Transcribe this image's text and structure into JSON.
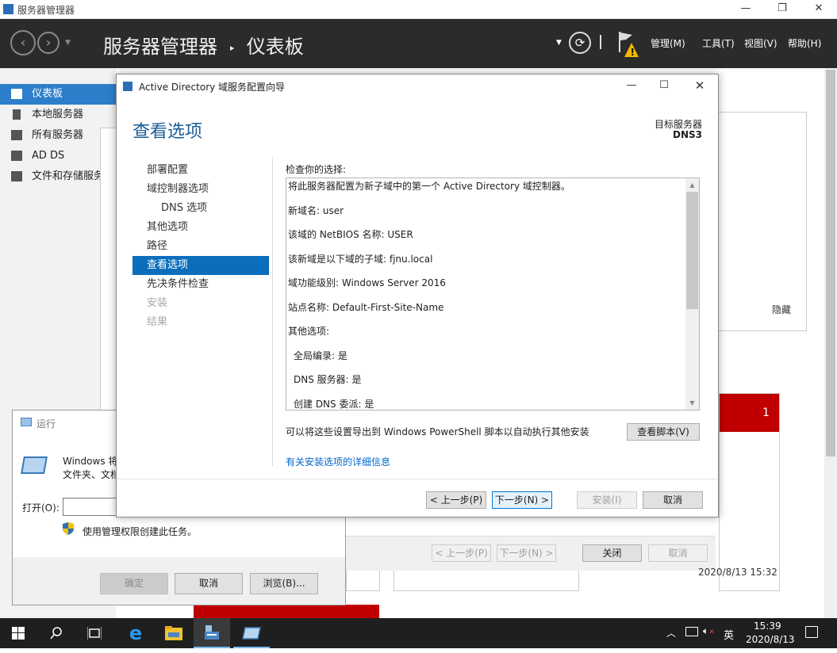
{
  "server_manager": {
    "title": "服务器管理器",
    "breadcrumb_app": "服务器管理器",
    "breadcrumb_sep": "‣",
    "breadcrumb_page": "仪表板",
    "menu": [
      "管理(M)",
      "工具(T)",
      "视图(V)",
      "帮助(H)"
    ],
    "sidebar": [
      "仪表板",
      "本地服务器",
      "所有服务器",
      "AD DS",
      "文件和存储服务"
    ],
    "hide_label": "隐藏",
    "alert_count": "1",
    "timestamp": "2020/8/13 15:32",
    "back_buttons": {
      "prev": "< 上一步(P)",
      "next": "下一步(N) >",
      "close": "关闭",
      "cancel": "取消"
    }
  },
  "run_dialog": {
    "title": "运行",
    "description_line1": "Windows 将",
    "description_line2": "文件夹、文档",
    "open_label": "打开(O):",
    "open_value": "",
    "admin_note": "使用管理权限创建此任务。",
    "buttons": {
      "ok": "确定",
      "cancel": "取消",
      "browse": "浏览(B)..."
    }
  },
  "wizard": {
    "title": "Active Directory 域服务配置向导",
    "heading": "查看选项",
    "target_label": "目标服务器",
    "target_server": "DNS3",
    "nav": [
      {
        "label": "部署配置",
        "state": "normal"
      },
      {
        "label": "域控制器选项",
        "state": "normal"
      },
      {
        "label": "DNS 选项",
        "state": "sub"
      },
      {
        "label": "其他选项",
        "state": "normal"
      },
      {
        "label": "路径",
        "state": "normal"
      },
      {
        "label": "查看选项",
        "state": "current"
      },
      {
        "label": "先决条件检查",
        "state": "normal"
      },
      {
        "label": "安装",
        "state": "dim"
      },
      {
        "label": "结果",
        "state": "dim"
      }
    ],
    "review_label": "检查你的选择:",
    "review_lines": [
      "将此服务器配置为新子域中的第一个 Active Directory 域控制器。",
      "新域名: user",
      "该域的 NetBIOS 名称: USER",
      "该新域是以下域的子域: fjnu.local",
      "域功能级别: Windows Server 2016",
      "站点名称: Default-First-Site-Name",
      "其他选项:",
      "全局编录: 是",
      "DNS 服务器: 是",
      "创建 DNS 委派: 是"
    ],
    "export_text": "可以将这些设置导出到 Windows PowerShell 脚本以自动执行其他安装",
    "view_script": "查看脚本(V)",
    "more_info_link": "有关安装选项的详细信息",
    "buttons": {
      "prev": "< 上一步(P)",
      "next": "下一步(N) >",
      "install": "安装(I)",
      "cancel": "取消"
    }
  },
  "taskbar": {
    "time": "15:39",
    "date": "2020/8/13",
    "ime": "英"
  },
  "colors": {
    "accent": "#0a6ebd",
    "alert_red": "#c00000",
    "header_bg": "#2b2b2b"
  }
}
